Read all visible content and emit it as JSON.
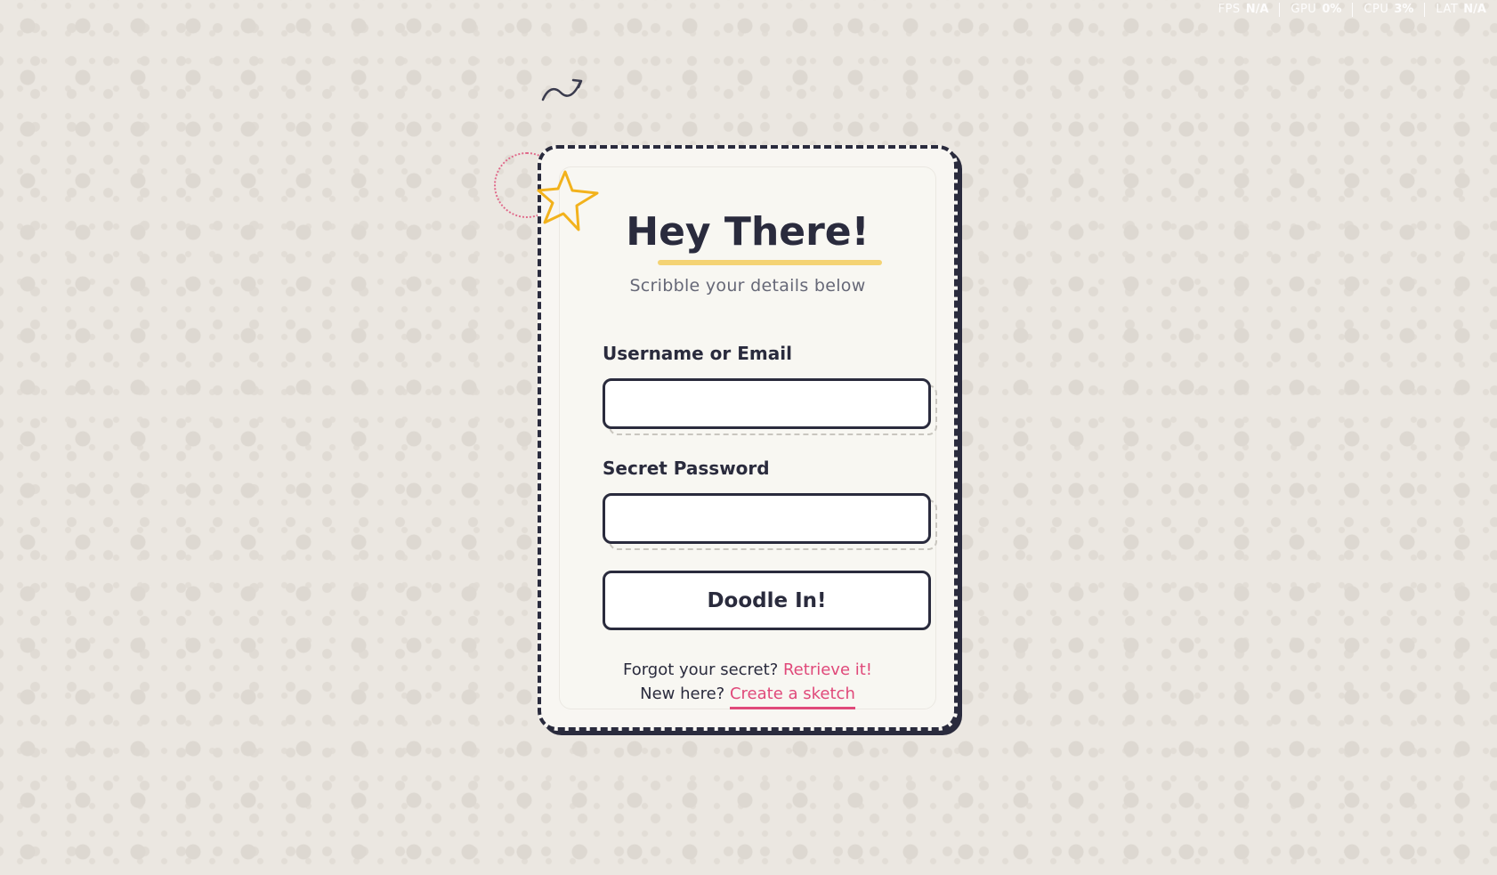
{
  "status_bar": {
    "items": [
      {
        "label": "FPS",
        "value": "N/A"
      },
      {
        "label": "GPU",
        "value": "0%"
      },
      {
        "label": "CPU",
        "value": "3%"
      },
      {
        "label": "LAT",
        "value": "N/A"
      }
    ]
  },
  "login": {
    "title": "Hey There!",
    "subtitle": "Scribble your details below",
    "username_label": "Username or Email",
    "username_value": "",
    "password_label": "Secret Password",
    "password_value": "",
    "submit_label": "Doodle In!",
    "forgot_text": "Forgot your secret?",
    "forgot_link": "Retrieve it!",
    "signup_text": "New here?",
    "signup_link": "Create a sketch"
  },
  "colors": {
    "ink": "#2a2b3d",
    "accent_pink": "#e0497a",
    "highlight_yellow": "#f4d374",
    "star_yellow": "#f2b21c",
    "background": "#ebe7e1"
  },
  "icons": {
    "decor_squiggle": "squiggle-icon",
    "decor_star": "star-icon",
    "decor_circle": "dotted-circle-icon"
  }
}
